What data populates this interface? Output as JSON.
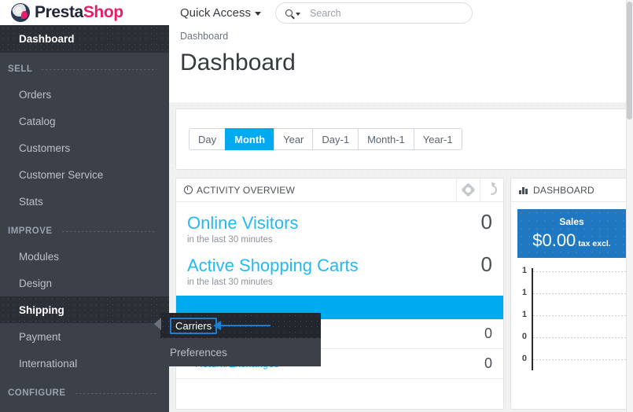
{
  "brand": {
    "part1": "Presta",
    "part2": "Shop",
    "logo_icon": "prestashop-mascot-icon"
  },
  "topbar": {
    "quick_access_label": "Quick Access",
    "quick_access_caret_icon": "chevron-down-icon",
    "search_icon": "search-icon",
    "search_caret_icon": "chevron-down-icon",
    "search_placeholder": "Search",
    "search_value": ""
  },
  "page": {
    "breadcrumb": "Dashboard",
    "title": "Dashboard"
  },
  "sidebar": {
    "dashboard": {
      "label": "Dashboard",
      "active": true
    },
    "sections": [
      {
        "label": "SELL",
        "items": [
          {
            "label": "Orders"
          },
          {
            "label": "Catalog"
          },
          {
            "label": "Customers"
          },
          {
            "label": "Customer Service"
          },
          {
            "label": "Stats"
          }
        ]
      },
      {
        "label": "IMPROVE",
        "items": [
          {
            "label": "Modules"
          },
          {
            "label": "Design"
          },
          {
            "label": "Shipping",
            "active": true
          },
          {
            "label": "Payment"
          },
          {
            "label": "International"
          }
        ]
      },
      {
        "label": "CONFIGURE",
        "items": []
      }
    ]
  },
  "submenu": {
    "parent": "Shipping",
    "items": [
      {
        "label": "Carriers",
        "highlighted": true
      },
      {
        "label": "Preferences",
        "highlighted": false
      }
    ],
    "highlight_color": "#1b7fd0",
    "annotation_arrow_icon": "left-arrow-annotation-icon"
  },
  "date_filter": {
    "buttons": [
      {
        "label": "Day",
        "active": false
      },
      {
        "label": "Month",
        "active": true
      },
      {
        "label": "Year",
        "active": false
      },
      {
        "label": "Day-1",
        "active": false
      },
      {
        "label": "Month-1",
        "active": false
      },
      {
        "label": "Year-1",
        "active": false
      }
    ],
    "active_color": "#00aaf0"
  },
  "activity_overview": {
    "title": "ACTIVITY OVERVIEW",
    "clock_icon": "clock-icon",
    "gear_icon": "gear-icon",
    "refresh_icon": "refresh-icon",
    "kpis": [
      {
        "title": "Online Visitors",
        "subtitle": "in the last 30 minutes",
        "value": "0"
      },
      {
        "title": "Active Shopping Carts",
        "subtitle": "in the last 30 minutes",
        "value": "0"
      }
    ],
    "rows": [
      {
        "label": "",
        "value": "0"
      },
      {
        "label": "Return/Exchanges",
        "value": "0"
      },
      {
        "label": "",
        "value": ""
      }
    ]
  },
  "dashboard_panel": {
    "title": "DASHBOARD",
    "chart_icon": "bar-chart-icon",
    "sales_tile": {
      "label": "Sales",
      "amount": "$0.00",
      "tax_note": "tax excl.",
      "color": "#1f78c1"
    }
  },
  "chart_data": {
    "type": "line",
    "title": "",
    "xlabel": "",
    "ylabel": "",
    "x": [],
    "series": [
      {
        "name": "Sales",
        "values": []
      }
    ],
    "ytick_labels": [
      "1",
      "1",
      "1",
      "0",
      "0"
    ],
    "ylim": [
      0,
      1
    ],
    "grid": true,
    "legend": "none"
  }
}
